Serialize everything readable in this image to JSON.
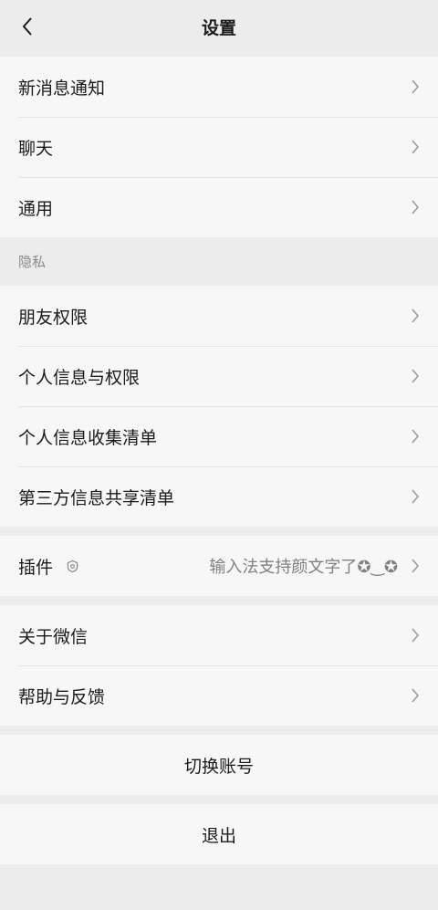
{
  "header": {
    "title": "设置"
  },
  "group1": [
    {
      "label": "新消息通知"
    },
    {
      "label": "聊天"
    },
    {
      "label": "通用"
    }
  ],
  "privacy": {
    "section_label": "隐私",
    "items": [
      {
        "label": "朋友权限"
      },
      {
        "label": "个人信息与权限"
      },
      {
        "label": "个人信息收集清单"
      },
      {
        "label": "第三方信息共享清单"
      }
    ]
  },
  "plugins": {
    "label": "插件",
    "value": "输入法支持颜文字了✪‿✪"
  },
  "group4": [
    {
      "label": "关于微信"
    },
    {
      "label": "帮助与反馈"
    }
  ],
  "actions": {
    "switch_account": "切换账号",
    "logout": "退出"
  },
  "icons": {
    "back": "chevron-left-icon",
    "row_arrow": "chevron-right-icon",
    "plugin": "plugin-badge-icon"
  },
  "colors": {
    "background": "#ececec",
    "cell": "#f7f7f7",
    "secondary_text": "#8a8a8a"
  }
}
